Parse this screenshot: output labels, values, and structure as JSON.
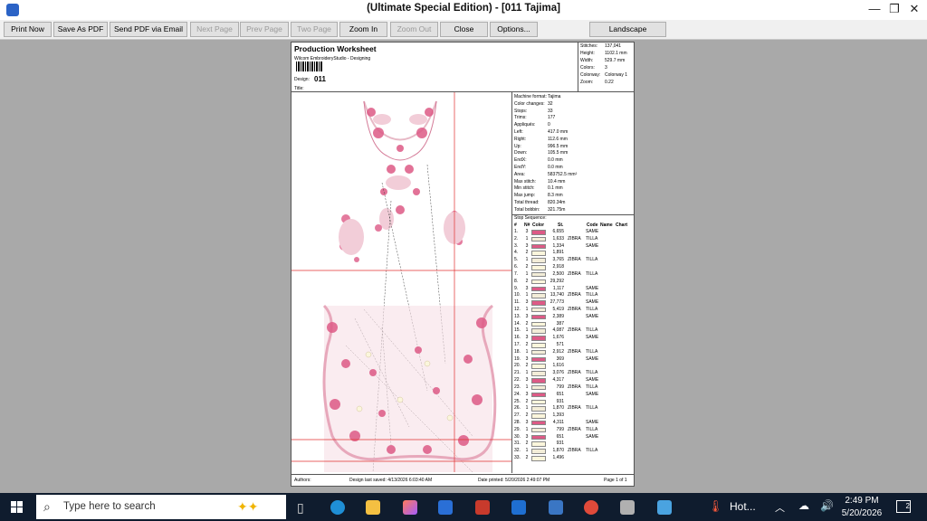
{
  "titlebar": {
    "title": "(Ultimate Special Edition) - [011          Tajima]",
    "minimize": "—",
    "restore": "❐",
    "close": "✕"
  },
  "toolbar": {
    "buttons": [
      {
        "label": "Print Now",
        "enabled": true
      },
      {
        "label": "Save As PDF",
        "enabled": true
      },
      {
        "label": "Send PDF via Email",
        "enabled": true
      },
      {
        "label": "Next Page",
        "enabled": false
      },
      {
        "label": "Prev Page",
        "enabled": false
      },
      {
        "label": "Two Page",
        "enabled": false
      },
      {
        "label": "Zoom In",
        "enabled": true
      },
      {
        "label": "Zoom Out",
        "enabled": false
      },
      {
        "label": "Close",
        "enabled": true
      },
      {
        "label": "Options...",
        "enabled": true
      },
      {
        "label": "Landscape",
        "enabled": true
      }
    ]
  },
  "worksheet": {
    "title": "Production Worksheet",
    "company": "Wilcom EmbroideryStudio - Designing",
    "design_label": "Design:",
    "design_value": "011",
    "title_label": "Title:",
    "header_stats": [
      {
        "k": "Stitches:",
        "v": "137,041"
      },
      {
        "k": "Height:",
        "v": "1102.1 mm"
      },
      {
        "k": "Width:",
        "v": "529.7 mm"
      },
      {
        "k": "Colors:",
        "v": "3"
      },
      {
        "k": "Colorway:",
        "v": "Colorway 1"
      },
      {
        "k": "Zoom:",
        "v": "0.22"
      }
    ],
    "machine_stats": [
      {
        "k": "Machine format:",
        "v": "Tajima"
      },
      {
        "k": "Color changes:",
        "v": "32"
      },
      {
        "k": "Stops:",
        "v": "33"
      },
      {
        "k": "Trims:",
        "v": "177"
      },
      {
        "k": "Appliqués:",
        "v": "0"
      },
      {
        "k": "Left:",
        "v": "417.0 mm"
      },
      {
        "k": "Right:",
        "v": "112.6 mm"
      },
      {
        "k": "Up:",
        "v": "996.5 mm"
      },
      {
        "k": "Down:",
        "v": "105.5 mm"
      },
      {
        "k": "EndX:",
        "v": "0.0 mm"
      },
      {
        "k": "EndY:",
        "v": "0.0 mm"
      },
      {
        "k": "Area:",
        "v": "583752.5 mm²"
      },
      {
        "k": "Max stitch:",
        "v": "10.4 mm"
      },
      {
        "k": "Min stitch:",
        "v": "0.1 mm"
      },
      {
        "k": "Max jump:",
        "v": "8.3 mm"
      },
      {
        "k": "Total thread:",
        "v": "820.34m"
      },
      {
        "k": "Total bobbin:",
        "v": "321.75m"
      }
    ],
    "stop_sequence_title": "Stop Sequence:",
    "columns": {
      "num": "#",
      "n": "N#",
      "color": "Color",
      "st": "St.",
      "code": "Code",
      "name": "Name",
      "chart": "Chart"
    },
    "color_map": {
      "1": "#f3edd8",
      "2": "#fbf6dc",
      "3": "#dd5a86"
    },
    "stops": [
      {
        "num": "1.",
        "n": "3",
        "st": "6,655",
        "code": "",
        "name": "SAME"
      },
      {
        "num": "2.",
        "n": "1",
        "st": "1,633",
        "code": "ZIBRA",
        "name": "TILLA"
      },
      {
        "num": "3.",
        "n": "3",
        "st": "1,334",
        "code": "",
        "name": "SAME"
      },
      {
        "num": "4.",
        "n": "2",
        "st": "1,891",
        "code": "",
        "name": ""
      },
      {
        "num": "5.",
        "n": "1",
        "st": "3,765",
        "code": "ZIBRA",
        "name": "TILLA"
      },
      {
        "num": "6.",
        "n": "2",
        "st": "2,918",
        "code": "",
        "name": ""
      },
      {
        "num": "7.",
        "n": "1",
        "st": "2,500",
        "code": "ZIBRA",
        "name": "TILLA"
      },
      {
        "num": "8.",
        "n": "2",
        "st": "29,292",
        "code": "",
        "name": ""
      },
      {
        "num": "9.",
        "n": "3",
        "st": "1,117",
        "code": "",
        "name": "SAME"
      },
      {
        "num": "10.",
        "n": "1",
        "st": "13,740",
        "code": "ZIBRA",
        "name": "TILLA"
      },
      {
        "num": "11.",
        "n": "3",
        "st": "27,773",
        "code": "",
        "name": "SAME"
      },
      {
        "num": "12.",
        "n": "1",
        "st": "5,419",
        "code": "ZIBRA",
        "name": "TILLA"
      },
      {
        "num": "13.",
        "n": "3",
        "st": "2,389",
        "code": "",
        "name": "SAME"
      },
      {
        "num": "14.",
        "n": "2",
        "st": "387",
        "code": "",
        "name": ""
      },
      {
        "num": "15.",
        "n": "1",
        "st": "4,087",
        "code": "ZIBRA",
        "name": "TILLA"
      },
      {
        "num": "16.",
        "n": "3",
        "st": "1,676",
        "code": "",
        "name": "SAME"
      },
      {
        "num": "17.",
        "n": "2",
        "st": "571",
        "code": "",
        "name": ""
      },
      {
        "num": "18.",
        "n": "1",
        "st": "2,912",
        "code": "ZIBRA",
        "name": "TILLA"
      },
      {
        "num": "19.",
        "n": "3",
        "st": "369",
        "code": "",
        "name": "SAME"
      },
      {
        "num": "20.",
        "n": "2",
        "st": "1,616",
        "code": "",
        "name": ""
      },
      {
        "num": "21.",
        "n": "1",
        "st": "3,076",
        "code": "ZIBRA",
        "name": "TILLA"
      },
      {
        "num": "22.",
        "n": "3",
        "st": "4,317",
        "code": "",
        "name": "SAME"
      },
      {
        "num": "23.",
        "n": "1",
        "st": "799",
        "code": "ZIBRA",
        "name": "TILLA"
      },
      {
        "num": "24.",
        "n": "3",
        "st": "651",
        "code": "",
        "name": "SAME"
      },
      {
        "num": "25.",
        "n": "2",
        "st": "931",
        "code": "",
        "name": ""
      },
      {
        "num": "26.",
        "n": "1",
        "st": "1,870",
        "code": "ZIBRA",
        "name": "TILLA"
      },
      {
        "num": "27.",
        "n": "2",
        "st": "1,393",
        "code": "",
        "name": ""
      },
      {
        "num": "28.",
        "n": "3",
        "st": "4,311",
        "code": "",
        "name": "SAME"
      },
      {
        "num": "29.",
        "n": "1",
        "st": "799",
        "code": "ZIBRA",
        "name": "TILLA"
      },
      {
        "num": "30.",
        "n": "3",
        "st": "651",
        "code": "",
        "name": "SAME"
      },
      {
        "num": "31.",
        "n": "2",
        "st": "931",
        "code": "",
        "name": ""
      },
      {
        "num": "32.",
        "n": "1",
        "st": "1,870",
        "code": "ZIBRA",
        "name": "TILLA"
      },
      {
        "num": "33.",
        "n": "2",
        "st": "1,496",
        "code": "",
        "name": ""
      }
    ],
    "footer": {
      "authors": "Authors:",
      "last_saved": "Design last saved: 4/13/2026 6:03:40 AM",
      "printed": "Date printed: 5/20/2026 2:49:07 PM",
      "page": "Page 1 of 1"
    }
  },
  "taskbar": {
    "search_placeholder": "Type here to search",
    "weather": "Hot...",
    "time": "2:49 PM",
    "date": "5/20/2026",
    "notification_count": "2",
    "accent": "#0f1c2e"
  }
}
